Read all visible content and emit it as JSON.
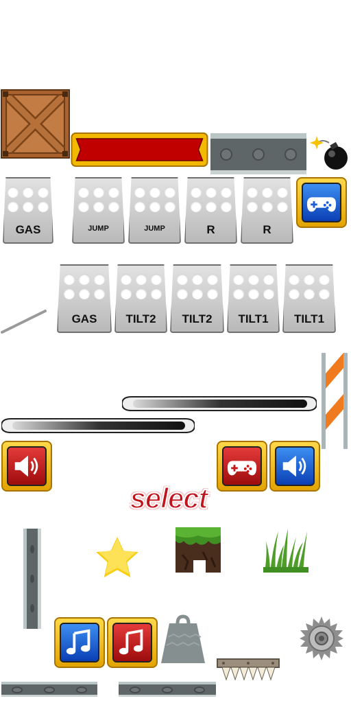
{
  "pedals_row1": [
    {
      "label": "GAS"
    },
    {
      "label": "JUMP"
    },
    {
      "label": "JUMP"
    },
    {
      "label": "R"
    },
    {
      "label": "R"
    }
  ],
  "pedals_row2": [
    {
      "label": "GAS"
    },
    {
      "label": "TILT2"
    },
    {
      "label": "TILT2"
    },
    {
      "label": "TILT1"
    },
    {
      "label": "TILT1"
    }
  ],
  "select_label": "select",
  "icons": {
    "gamepad": "gamepad-icon",
    "speaker": "speaker-icon",
    "music": "music-note-icon",
    "star": "star-icon",
    "bomb": "bomb-icon",
    "saw": "saw-blade-icon",
    "weight": "weight-icon",
    "spikes": "spikes-icon"
  },
  "colors": {
    "frame_gold": "#f2b900",
    "button_blue": "#1d5fd8",
    "button_red": "#c41818",
    "banner_red": "#c00000",
    "crate_brown": "#b5713a",
    "steel": "#5f6668"
  }
}
